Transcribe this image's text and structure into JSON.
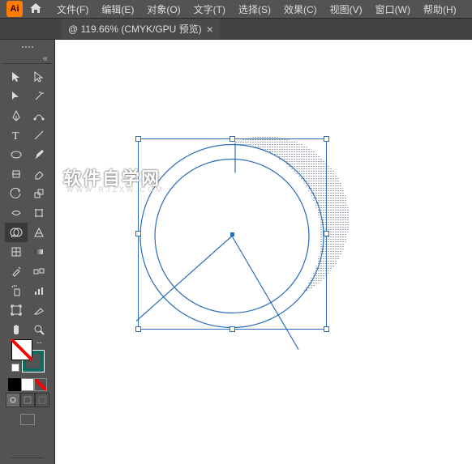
{
  "app": {
    "icon_label": "Ai"
  },
  "menu": {
    "file": "文件(F)",
    "edit": "编辑(E)",
    "object": "对象(O)",
    "type": "文字(T)",
    "select": "选择(S)",
    "effect": "效果(C)",
    "view": "视图(V)",
    "window": "窗口(W)",
    "help": "帮助(H)"
  },
  "tab": {
    "title": "@ 119.66% (CMYK/GPU 预览)",
    "close": "×"
  },
  "tools": {
    "collapse": "«",
    "selection": "selection",
    "direct_select": "direct-selection",
    "group_select": "group-selection",
    "magic_wand": "magic-wand",
    "pen": "pen",
    "curvature": "curvature",
    "type": "type",
    "line": "line",
    "ellipse": "ellipse",
    "brush": "brush",
    "shaper": "shaper",
    "eraser": "eraser",
    "rotate": "rotate",
    "scale": "scale",
    "width": "width",
    "free_transform": "free-transform",
    "shape_builder": "shape-builder",
    "perspective": "perspective",
    "mesh": "mesh",
    "gradient": "gradient",
    "eyedropper": "eyedropper",
    "blend": "blend",
    "symbol_spray": "symbol-spray",
    "graph": "graph",
    "artboard": "artboard",
    "slice": "slice",
    "hand": "hand",
    "zoom": "zoom"
  },
  "swatches": {
    "swap": "↔",
    "colors": [
      "#000000",
      "#ffffff",
      "none"
    ]
  },
  "watermark": {
    "main": "软件自学网",
    "sub": "WWW.RJZXW.COM"
  }
}
